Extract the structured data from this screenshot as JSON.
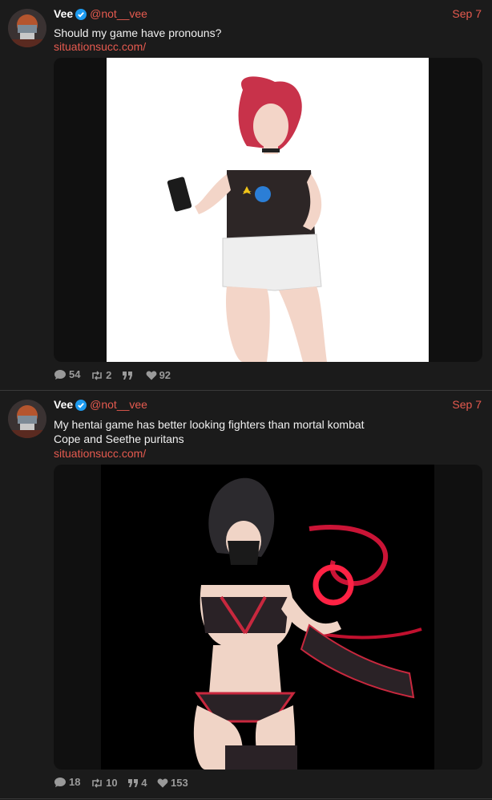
{
  "tweets": [
    {
      "name": "Vee",
      "handle": "@not__vee",
      "date": "Sep 7",
      "lines": [
        "Should my game have pronouns?"
      ],
      "link": "situationsucc.com/",
      "media_background": "#ffffff",
      "stats": {
        "replies": "54",
        "retweets": "2",
        "quotes": "",
        "likes": "92"
      }
    },
    {
      "name": "Vee",
      "handle": "@not__vee",
      "date": "Sep 7",
      "lines": [
        "My hentai game has better looking fighters than mortal kombat",
        "Cope and Seethe puritans"
      ],
      "link": "situationsucc.com/",
      "media_background": "#000000",
      "stats": {
        "replies": "18",
        "retweets": "10",
        "quotes": "4",
        "likes": "153"
      }
    }
  ],
  "colors": {
    "accent": "#e55a4f",
    "verified": "#1d9bf0",
    "background": "#1b1b1b"
  },
  "icons": [
    "verified-badge-icon",
    "reply-icon",
    "retweet-icon",
    "quote-icon",
    "like-icon"
  ]
}
